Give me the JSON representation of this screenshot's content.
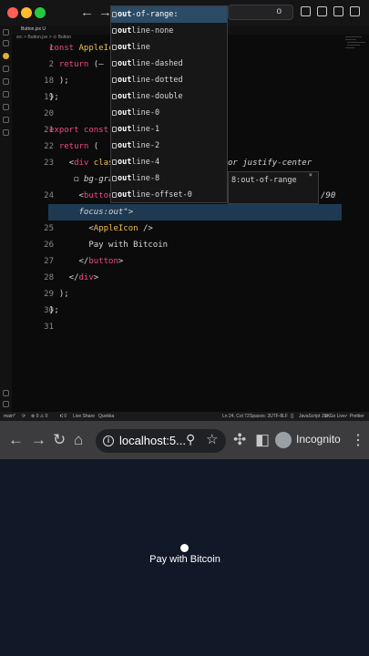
{
  "editor": {
    "window_search": "o",
    "tab_label": "Button.jsx U",
    "breadcrumb": "src > Button.jsx > ⊙ Button",
    "lines": [
      {
        "n": "1",
        "parts": [
          [
            "kw",
            "const "
          ],
          [
            "fn",
            "AppleIcon"
          ],
          [
            "plain",
            " = "
          ]
        ]
      },
      {
        "n": "2",
        "parts": [
          [
            "kw",
            "  return "
          ],
          [
            "plain",
            "(–"
          ]
        ]
      },
      {
        "n": "18",
        "parts": [
          [
            "plain",
            "  );"
          ]
        ]
      },
      {
        "n": "19",
        "parts": [
          [
            "plain",
            "};"
          ]
        ]
      },
      {
        "n": "20",
        "parts": [
          [
            "plain",
            ""
          ]
        ]
      },
      {
        "n": "21",
        "parts": [
          [
            "kw",
            "export const "
          ],
          [
            "fn",
            "Bu"
          ]
        ]
      },
      {
        "n": "22",
        "parts": [
          [
            "kw",
            "  return "
          ],
          [
            "plain",
            "("
          ]
        ]
      },
      {
        "n": "23",
        "parts": [
          [
            "plain",
            "    <"
          ],
          [
            "tag",
            "div "
          ],
          [
            "attr",
            "classN"
          ]
        ]
      },
      {
        "n": "",
        "parts": [
          [
            "plain",
            "     ◻ "
          ],
          [
            "str",
            "bg-gray-9"
          ]
        ]
      },
      {
        "n": "24",
        "parts": [
          [
            "plain",
            "      <"
          ],
          [
            "tag",
            "button "
          ],
          [
            "attr",
            "c"
          ]
        ]
      },
      {
        "n": "",
        "parts": [
          [
            "str",
            "      focus:out"
          ],
          [
            "plain",
            "\""
          ],
          [
            "plain",
            ">"
          ]
        ]
      },
      {
        "n": "25",
        "parts": [
          [
            "plain",
            "        <"
          ],
          [
            "fn",
            "AppleIcon "
          ],
          [
            "plain",
            "/>"
          ]
        ]
      },
      {
        "n": "26",
        "parts": [
          [
            "plain",
            "        Pay with Bitcoin"
          ]
        ]
      },
      {
        "n": "27",
        "parts": [
          [
            "plain",
            "      </"
          ],
          [
            "tag",
            "button"
          ],
          [
            "plain",
            ">"
          ]
        ]
      },
      {
        "n": "28",
        "parts": [
          [
            "plain",
            "    </"
          ],
          [
            "tag",
            "div"
          ],
          [
            "plain",
            ">"
          ]
        ]
      },
      {
        "n": "29",
        "parts": [
          [
            "plain",
            "  );"
          ]
        ]
      },
      {
        "n": "30",
        "parts": [
          [
            "plain",
            "};"
          ]
        ]
      },
      {
        "n": "31",
        "parts": [
          [
            "plain",
            ""
          ]
        ]
      }
    ],
    "overflow_right_23": "or justify-center",
    "overflow_right_24": "/90",
    "suggestions": [
      {
        "prefix": "out",
        "rest": "-of-range:",
        "selected": true
      },
      {
        "prefix": "out",
        "rest": "line-none",
        "selected": false
      },
      {
        "prefix": "out",
        "rest": "line",
        "selected": false
      },
      {
        "prefix": "out",
        "rest": "line-dashed",
        "selected": false
      },
      {
        "prefix": "out",
        "rest": "line-dotted",
        "selected": false
      },
      {
        "prefix": "out",
        "rest": "line-double",
        "selected": false
      },
      {
        "prefix": "out",
        "rest": "line-0",
        "selected": false
      },
      {
        "prefix": "out",
        "rest": "line-1",
        "selected": false
      },
      {
        "prefix": "out",
        "rest": "line-2",
        "selected": false
      },
      {
        "prefix": "out",
        "rest": "line-4",
        "selected": false
      },
      {
        "prefix": "out",
        "rest": "line-8",
        "selected": false
      },
      {
        "prefix": "out",
        "rest": "line-offset-0",
        "selected": false
      }
    ],
    "suggestion_detail": "8:out-of-range",
    "status": {
      "branch": "main*",
      "sync": "⟳",
      "problems": "⊗ 0 ⚠ 0",
      "ports": "⑆ 0",
      "live_share": "Live Share",
      "quokka": "Quokka",
      "position": "Ln 24, Col 72",
      "spaces": "Spaces: 2",
      "encoding": "UTF-8",
      "eol": "LF",
      "braces": "{}",
      "language": "JavaScript JSX",
      "golive": "⊘ Go Live",
      "prettier": "✓ Prettier"
    }
  },
  "browser": {
    "back": "←",
    "forward": "→",
    "reload": "↻",
    "home": "⌂",
    "url": "localhost:5...",
    "zoom_icon": "⚲",
    "star_icon": "☆",
    "extensions_icon": "✣",
    "sidebar_icon": "◧",
    "incognito_label": "Incognito",
    "menu_icon": "⋮",
    "button_label": "Pay with Bitcoin"
  }
}
